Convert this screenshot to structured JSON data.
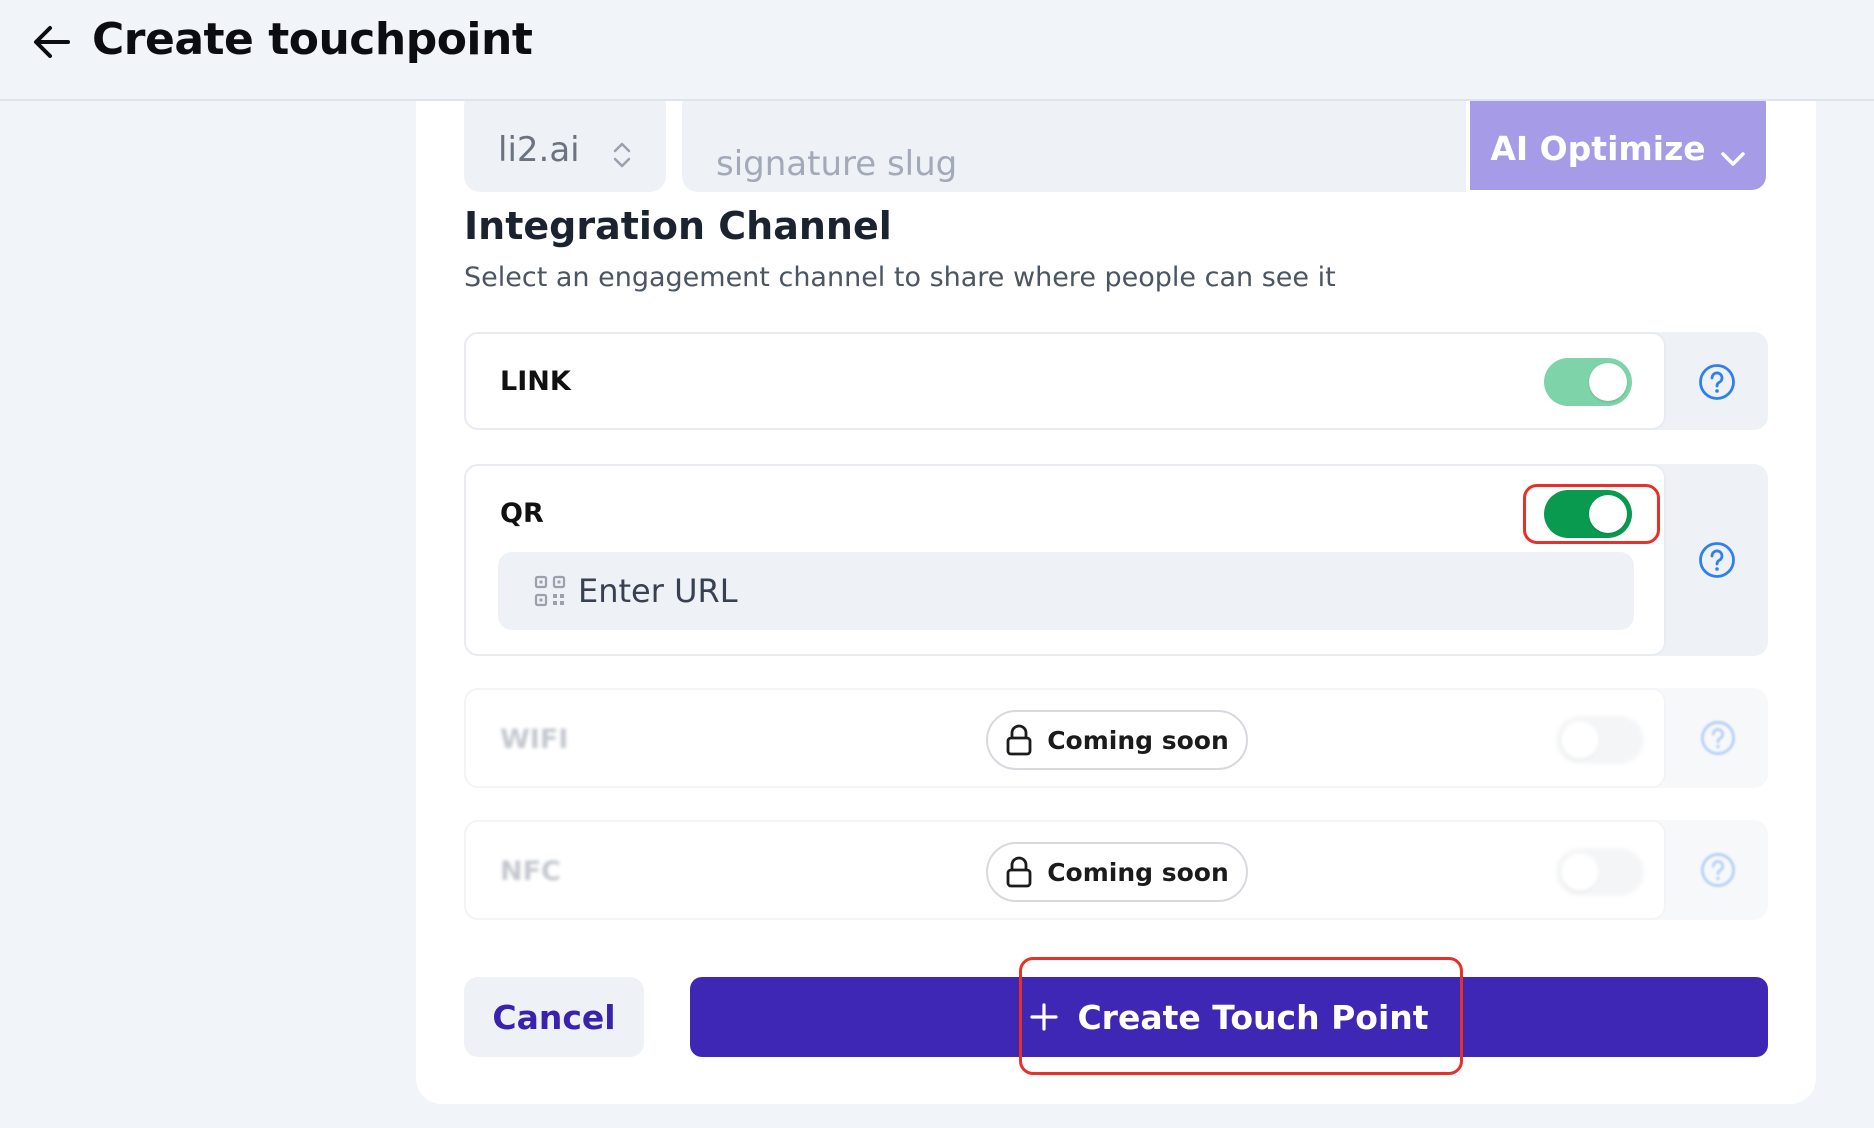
{
  "header": {
    "title": "Create touchpoint",
    "back_icon": "arrow-left-icon"
  },
  "slug": {
    "domain": "li2.ai",
    "placeholder": "signature slug",
    "ai_button_label": "AI Optimize"
  },
  "integration": {
    "title": "Integration Channel",
    "subtitle": "Select an engagement channel to share where people can see it"
  },
  "channels": [
    {
      "label": "LINK",
      "enabled": true,
      "toggle_color": "#7ed3a8"
    },
    {
      "label": "QR",
      "enabled": true,
      "toggle_color": "#0a9a4f",
      "url_placeholder": "Enter URL"
    },
    {
      "label": "WIFI",
      "enabled": false,
      "badge": "Coming soon"
    },
    {
      "label": "NFC",
      "enabled": false,
      "badge": "Coming soon"
    }
  ],
  "actions": {
    "cancel_label": "Cancel",
    "create_label": "Create Touch Point"
  },
  "colors": {
    "accent": "#3f27b5",
    "ai_button": "#a59be6",
    "highlight": "#e8302a",
    "help_icon": "#2f80ed"
  }
}
